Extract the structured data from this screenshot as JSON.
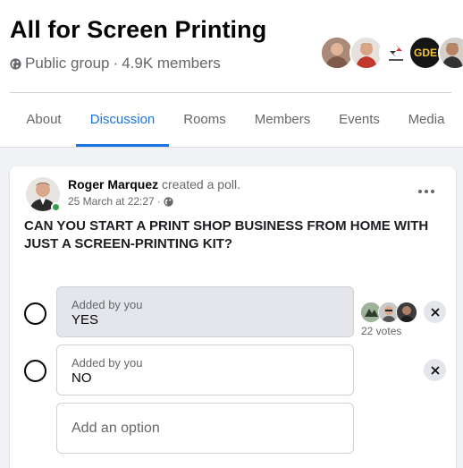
{
  "group": {
    "title": "All for Screen Printing",
    "privacy": "Public group",
    "separator": "·",
    "members": "4.9K members",
    "avatar_badge": "GDE"
  },
  "tabs": [
    {
      "label": "About",
      "active": false
    },
    {
      "label": "Discussion",
      "active": true
    },
    {
      "label": "Rooms",
      "active": false
    },
    {
      "label": "Members",
      "active": false
    },
    {
      "label": "Events",
      "active": false
    },
    {
      "label": "Media",
      "active": false
    }
  ],
  "post": {
    "author": "Roger Marquez",
    "action": "created a poll.",
    "timestamp": "25 March at 22:27",
    "separator": "·",
    "question": "CAN YOU START A PRINT SHOP BUSINESS FROM HOME WITH JUST A SCREEN-PRINTING KIT?"
  },
  "poll": {
    "options": [
      {
        "added_by": "Added by you",
        "text": "YES",
        "votes": "22 votes",
        "selected": false
      },
      {
        "added_by": "Added by you",
        "text": "NO",
        "votes": "",
        "selected": false
      }
    ],
    "add_placeholder": "Add an option"
  },
  "colors": {
    "accent": "#1b74e4",
    "muted_text": "#65676b",
    "online": "#31a24c",
    "page_bg": "#f0f2f5"
  },
  "icons": {
    "privacy": "globe-icon",
    "more": "more-options-icon",
    "remove": "close-icon"
  }
}
